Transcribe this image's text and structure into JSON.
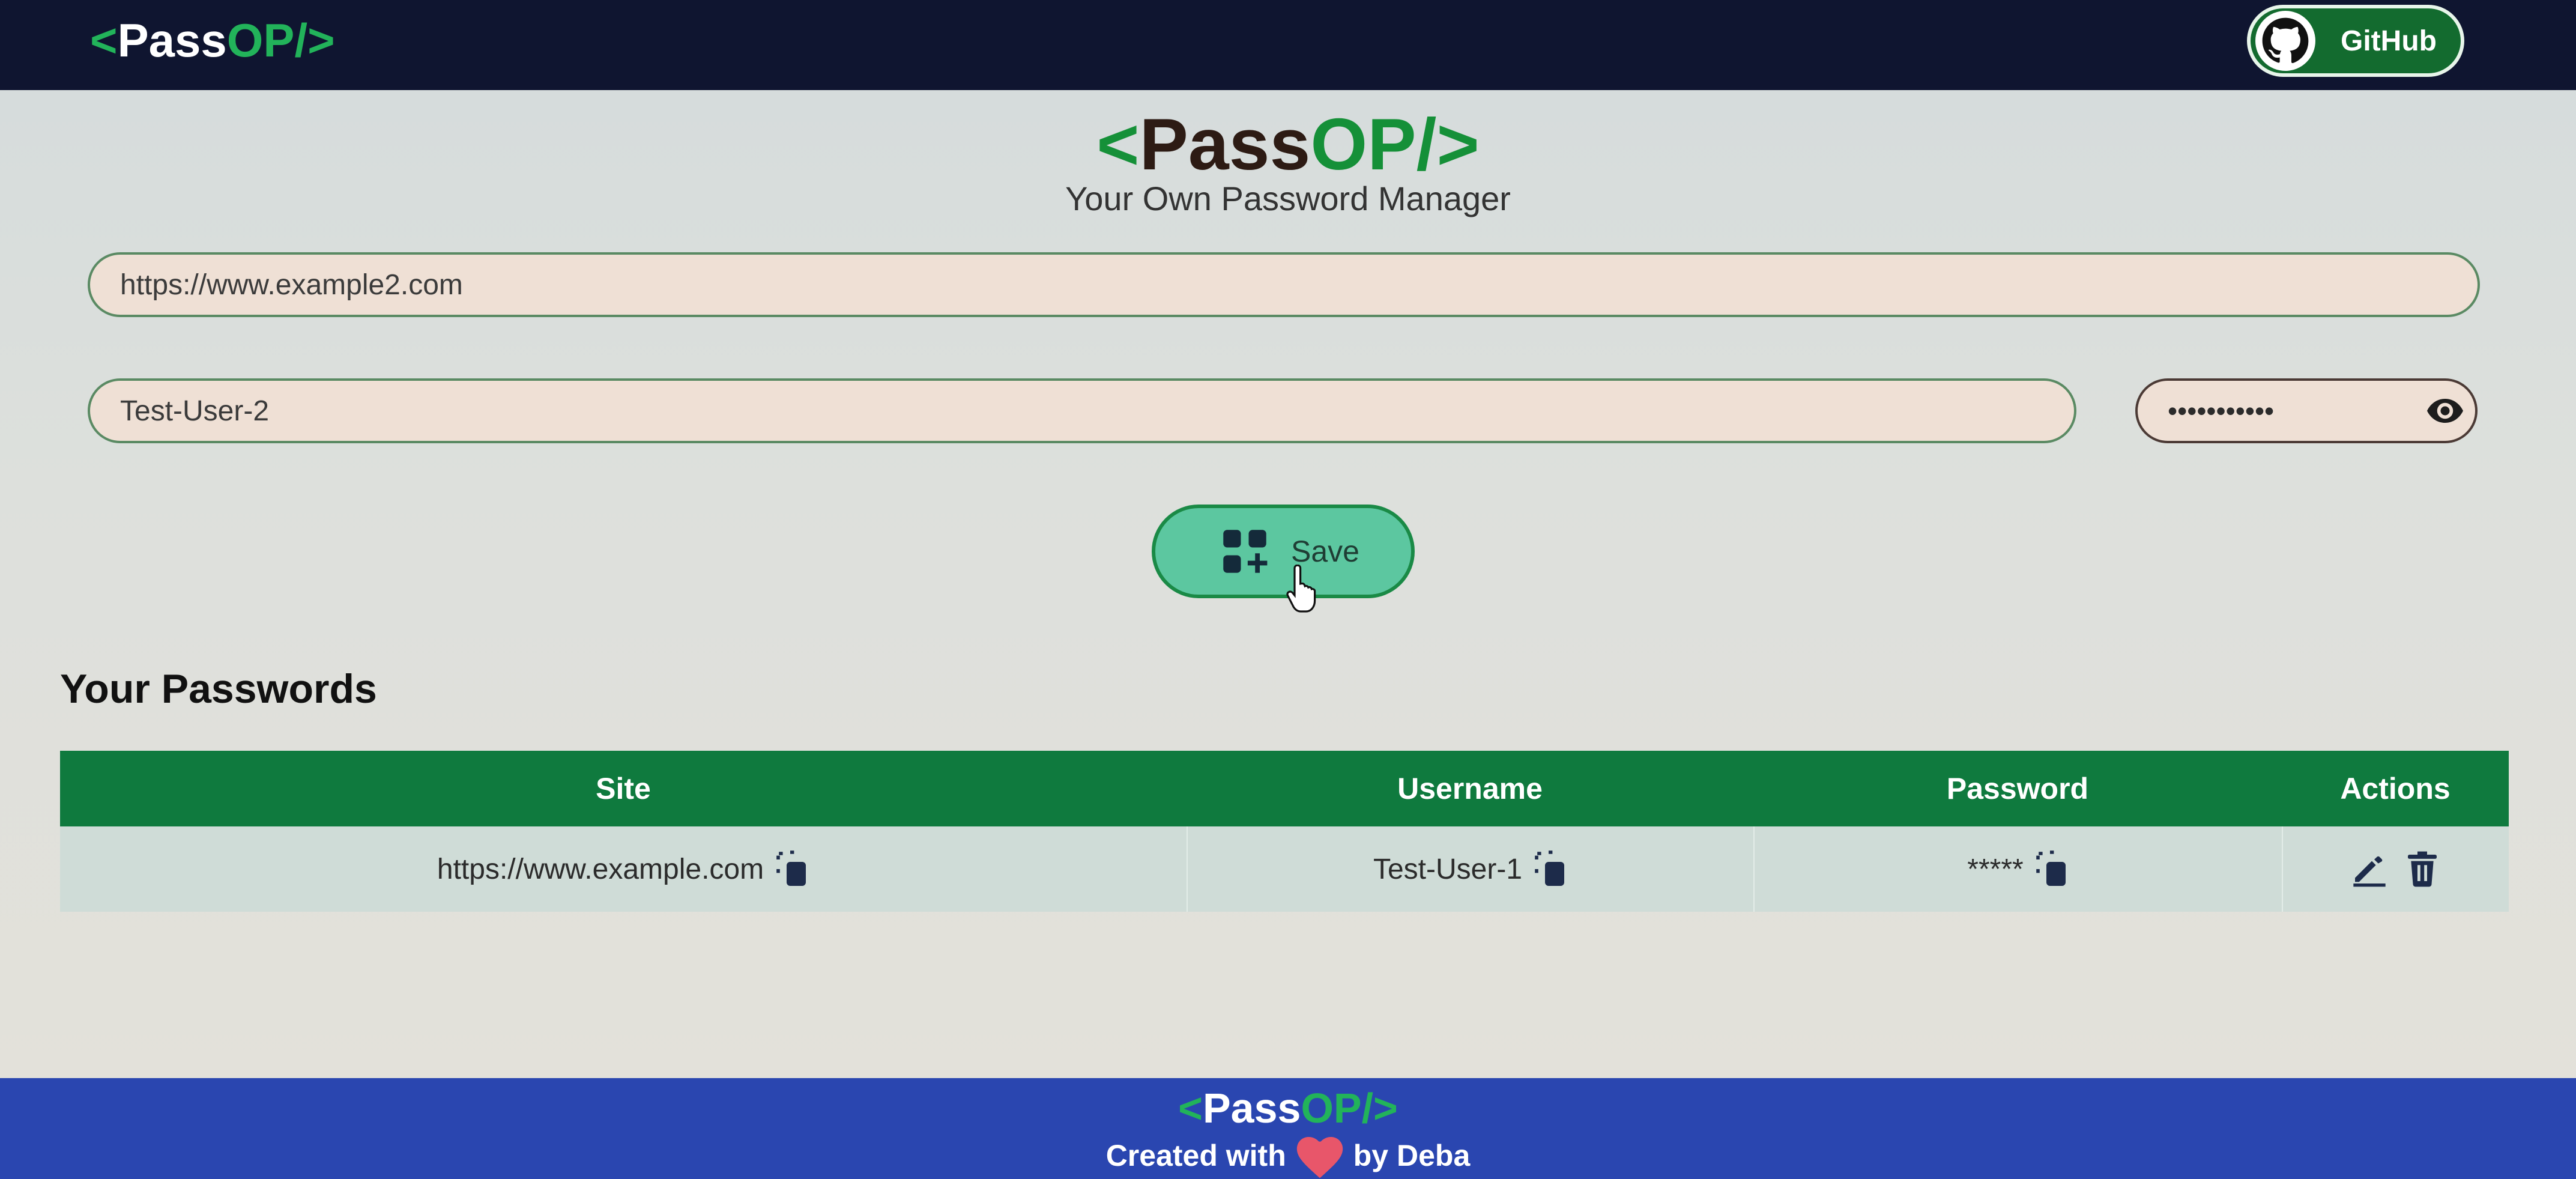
{
  "brand": {
    "open": "<",
    "pass": "Pass",
    "op": "OP",
    "close": "/>"
  },
  "nav": {
    "github_label": "GitHub"
  },
  "hero": {
    "tagline": "Your Own Password Manager"
  },
  "form": {
    "url_value": "https://www.example2.com",
    "username_value": "Test-User-2",
    "password_masked": "•••••••••••",
    "save_label": "Save"
  },
  "passwords": {
    "title": "Your Passwords",
    "columns": [
      "Site",
      "Username",
      "Password",
      "Actions"
    ],
    "rows": [
      {
        "site": "https://www.example.com",
        "username": "Test-User-1",
        "password": "*****"
      }
    ]
  },
  "footer": {
    "created_with": "Created with",
    "by": "by Deba"
  },
  "colors": {
    "accent_green": "#159038",
    "nav_bg": "#0f1530",
    "table_header": "#0f7a3e",
    "footer_bg": "#2a46b0",
    "save_bg": "#5cc7a0"
  },
  "icons": [
    "github-icon",
    "eye-icon",
    "add-grid-icon",
    "copy-icon",
    "edit-icon",
    "trash-icon",
    "heart-icon",
    "hand-cursor-icon"
  ]
}
